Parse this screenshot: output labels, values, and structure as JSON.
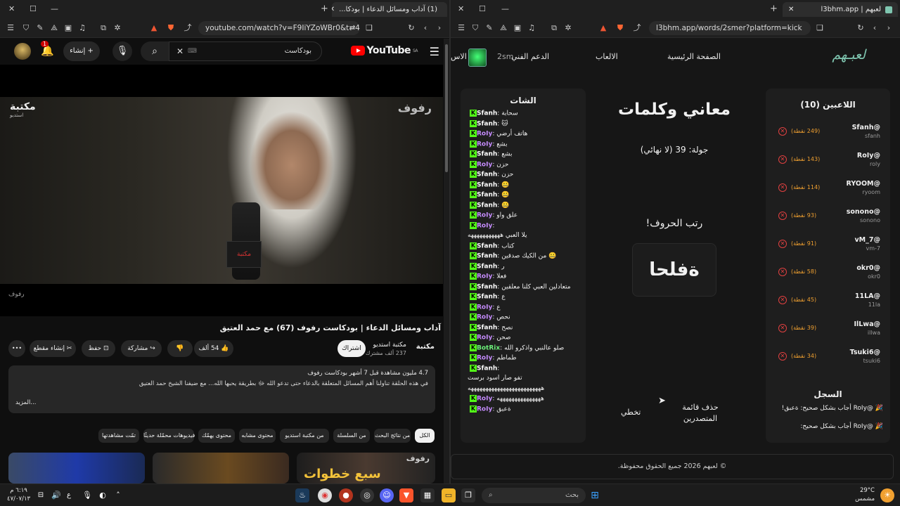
{
  "left_window": {
    "tab_title": "(1) آداب ومسائل الدعاء | بودكا...",
    "url": "youtube.com/watch?v=F9IiYZoWBr0&t=4s",
    "header": {
      "logo_text": "YouTube",
      "logo_region": "SA",
      "search_value": "بودكاست",
      "create_label": "إنشاء",
      "notif_count": "1"
    },
    "video": {
      "watermark_left": "مكتبة",
      "watermark_left_sub": "استديو",
      "watermark_right": "رفوف",
      "watermark_bottom": "رفوف",
      "mic_label": "مكتبة",
      "title": "آداب ومسائل الدعاء | بودكاست رفوف (67) مع حمد العتيق",
      "channel_name": "مكتبة استديو",
      "channel_subs": "237 ألف مشترك",
      "subscribe_label": "اشتراك",
      "like_count": "54 ألف",
      "share_label": "مشاركة",
      "save_label": "حفظ",
      "clip_label": "إنشاء مقطع",
      "more_label": "•••"
    },
    "description": {
      "stats": "4.7 مليون مشاهدة قبل 7 أشهر  بودكاست رفوف",
      "text": "في هذه الحلقة تناولنا أهم المسائل المتعلقة بالدعاء حتى تدعو الله ﷻ بطريقة يحبها الله... مع ضيفنا الشيخ حمد العتيق",
      "more": "...المزيد"
    },
    "chips": [
      "الكل",
      "من نتائج البحث",
      "من السلسلة",
      "من مكتبة استديو",
      "محتوى مشابه",
      "محتوى يهمّك",
      "فيديوهات محمّلة حديثًا",
      "تمّت مشاهدتها"
    ],
    "thumb_text": "سبع خطوات",
    "thumb_wm": "رفوف"
  },
  "right_window": {
    "tab_title": "لعبهم | l3bhm.app",
    "url": "l3bhm.app/words/2smer?platform=kick",
    "nav": {
      "brand": "لعبـهم",
      "home": "الصفحة الرئيسية",
      "games": "الالعاب",
      "support": "الدعم الفني",
      "user": "2sm",
      "trunc": "الاس"
    },
    "players_title": "اللاعبين (10)",
    "players": [
      {
        "name": "@Sfanh",
        "user": "sfanh",
        "points": "(249 نقطة)"
      },
      {
        "name": "@RoIy",
        "user": "roly",
        "points": "(143 نقطة)"
      },
      {
        "name": "@RYOOM",
        "user": "ryoom",
        "points": "(114 نقطة)"
      },
      {
        "name": "@sonono",
        "user": "sonono",
        "points": "(93 نقطة)"
      },
      {
        "name": "@vM_7",
        "user": "vm-7",
        "points": "(91 نقطة)"
      },
      {
        "name": "@okr0",
        "user": "okr0",
        "points": "(58 نقطة)"
      },
      {
        "name": "@11LA",
        "user": "11la",
        "points": "(45 نقطة)"
      },
      {
        "name": "@IlLwa",
        "user": "illwa",
        "points": "(39 نقطة)"
      },
      {
        "name": "@Tsuki6",
        "user": "tsuki6",
        "points": "(34 نقطة)"
      }
    ],
    "game": {
      "title": "معاني وكلمات",
      "round": "جولة: 39 (لا نهائي)",
      "prompt": "رتب الحروف!",
      "letters": "ةفلحا",
      "skip": "تخطي",
      "clear_line1": "حذف قائمة",
      "clear_line2": "المتصدرين"
    },
    "log_title": "السجل",
    "log": [
      "🎉 @RoIy أجاب بشكل صحيح: ةعبق!",
      "🎉 @RoIy أجاب بشكل صحيح:"
    ],
    "chat_title": "الشات",
    "chat": [
      {
        "user": "Sfanh",
        "msg": "سحابة"
      },
      {
        "user": "Sfanh",
        "msg": "🐱"
      },
      {
        "user": "RoIy",
        "msg": "هاتف أرضي"
      },
      {
        "user": "RoIy",
        "msg": "بشع"
      },
      {
        "user": "Sfanh",
        "msg": "بشع"
      },
      {
        "user": "RoIy",
        "msg": "حزن"
      },
      {
        "user": "Sfanh",
        "msg": "حزن"
      },
      {
        "user": "Sfanh",
        "msg": "🤐"
      },
      {
        "user": "Sfanh",
        "msg": "🤐"
      },
      {
        "user": "Sfanh",
        "msg": "🤐"
      },
      {
        "user": "RoIy",
        "msg": "علق واو"
      },
      {
        "user": "RoIy",
        "msg": ""
      },
      {
        "user": "",
        "msg": "يلا العبي هههههههههههه"
      },
      {
        "user": "Sfanh",
        "msg": "كتاب"
      },
      {
        "user": "Sfanh",
        "msg": "من الكيك صدقين 🤐"
      },
      {
        "user": "Sfanh",
        "msg": "ر"
      },
      {
        "user": "RoIy",
        "msg": "فعلا"
      },
      {
        "user": "Sfanh",
        "msg": "متعادلين العبي كلنا معلقين"
      },
      {
        "user": "Sfanh",
        "msg": "ع"
      },
      {
        "user": "RoIy",
        "msg": "ع"
      },
      {
        "user": "RoIy",
        "msg": "نحص"
      },
      {
        "user": "Sfanh",
        "msg": "نصح"
      },
      {
        "user": "RoIy",
        "msg": "صحن"
      },
      {
        "user": "BotRix",
        "msg": "صلو عالنبي واذكرو الله"
      },
      {
        "user": "RoIy",
        "msg": "طماطم"
      },
      {
        "user": "Sfanh",
        "msg": ""
      },
      {
        "user": "",
        "msg": "تفو صار اسود برست"
      },
      {
        "user": "",
        "msg": "هههههههههههههههههههههههههه"
      },
      {
        "user": "RoIy",
        "msg": "هههههههههههههههه"
      },
      {
        "user": "RoIy",
        "msg": "ةعبق"
      }
    ],
    "footer": "© لعبهم 2026 جميع الحقوق محفوظة."
  },
  "taskbar": {
    "search_placeholder": "بحث",
    "time": "٦:١٩ م",
    "date": "٤٧/٠٧/١٣",
    "lang": "ع",
    "temp": "29°C",
    "weather": "مشمس"
  }
}
